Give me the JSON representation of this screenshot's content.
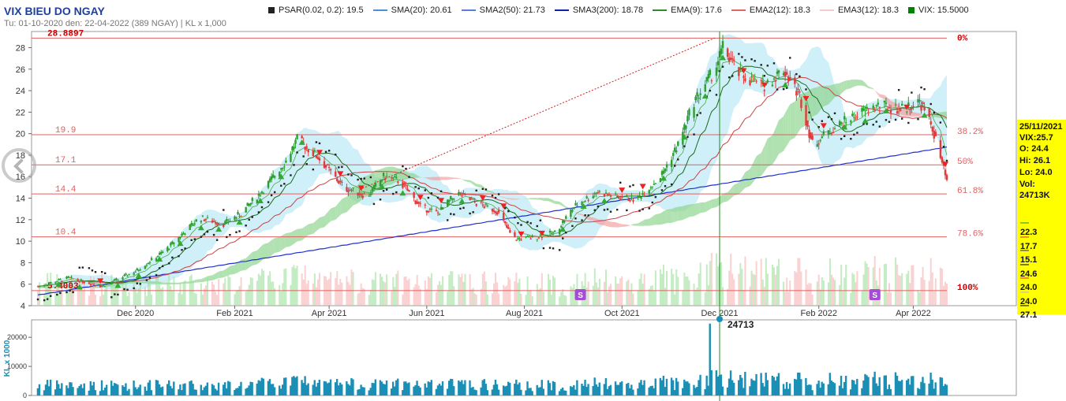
{
  "header": {
    "title": "VIX BIEU DO NGAY",
    "subtitle": "Tu: 01-10-2020 den: 22-04-2022 (389 NGAY) | KL x 1,000"
  },
  "legend": [
    {
      "label": "PSAR(0.02, 0.2): 19.5",
      "color": "#222222",
      "marker": "square"
    },
    {
      "label": "SMA(20): 20.61",
      "color": "#4a90d9",
      "marker": "dot-line"
    },
    {
      "label": "SMA2(50): 21.73",
      "color": "#5b7fd6",
      "marker": "diamond-line"
    },
    {
      "label": "SMA3(200): 18.78",
      "color": "#1020b0",
      "marker": "line"
    },
    {
      "label": "EMA(9): 17.6",
      "color": "#2e8b2e",
      "marker": "line"
    },
    {
      "label": "EMA2(12): 18.3",
      "color": "#e06666",
      "marker": "line"
    },
    {
      "label": "EMA3(12): 18.3",
      "color": "#f4cccc",
      "marker": "line"
    },
    {
      "label": "VIX: 15.5000",
      "color": "#008000",
      "marker": "box"
    }
  ],
  "colors": {
    "up": "#2e9e2e",
    "down": "#e23b3b",
    "sma20": "#1a6b1a",
    "sma200": "#1e2fd0",
    "ema": "#d04040",
    "fib": "#e06060",
    "cloud_green": "#8fd48f",
    "cloud_red": "#f4a0a0",
    "band": "#bfe9f7",
    "volume": "#1b8fb5",
    "side_box": "#ffff00"
  },
  "chart_data": {
    "type": "candlestick",
    "x_tick_labels": [
      "Dec 2020",
      "Feb 2021",
      "Apr 2021",
      "Jun 2021",
      "Aug 2021",
      "Oct 2021",
      "Dec 2021",
      "Feb 2022",
      "Apr 2022"
    ],
    "y_ticks": [
      4,
      6,
      8,
      10,
      12,
      14,
      16,
      18,
      20,
      22,
      24,
      26,
      28
    ],
    "ylim": [
      4,
      29.5
    ],
    "fib_levels": [
      {
        "price": 28.8897,
        "label": "28.8897",
        "pct": "0%"
      },
      {
        "price": 19.9,
        "label": "19.9",
        "pct": "38.2%"
      },
      {
        "price": 17.1,
        "label": "17.1",
        "pct": "50%"
      },
      {
        "price": 14.4,
        "label": "14.4",
        "pct": "61.8%"
      },
      {
        "price": 10.4,
        "label": "10.4",
        "pct": "78.6%"
      },
      {
        "price": 5.4003,
        "label": "5.4003",
        "pct": "100%"
      }
    ],
    "anchors": [
      [
        "2020-10-01",
        5.8
      ],
      [
        "2020-10-20",
        6.6
      ],
      [
        "2020-11-10",
        5.8
      ],
      [
        "2020-12-01",
        7.2
      ],
      [
        "2020-12-20",
        9.2
      ],
      [
        "2021-01-10",
        12.2
      ],
      [
        "2021-01-25",
        11.6
      ],
      [
        "2021-02-05",
        12.6
      ],
      [
        "2021-02-20",
        15.0
      ],
      [
        "2021-03-05",
        17.5
      ],
      [
        "2021-03-12",
        19.5
      ],
      [
        "2021-03-25",
        17.8
      ],
      [
        "2021-04-10",
        15.0
      ],
      [
        "2021-04-25",
        14.2
      ],
      [
        "2021-05-05",
        16.0
      ],
      [
        "2021-05-15",
        15.6
      ],
      [
        "2021-05-28",
        13.2
      ],
      [
        "2021-06-08",
        12.6
      ],
      [
        "2021-06-20",
        14.5
      ],
      [
        "2021-07-01",
        13.6
      ],
      [
        "2021-07-15",
        12.8
      ],
      [
        "2021-07-25",
        10.2
      ],
      [
        "2021-08-05",
        10.3
      ],
      [
        "2021-08-20",
        10.8
      ],
      [
        "2021-09-01",
        13.2
      ],
      [
        "2021-09-15",
        14.6
      ],
      [
        "2021-09-28",
        14.1
      ],
      [
        "2021-10-10",
        13.9
      ],
      [
        "2021-10-25",
        16.0
      ],
      [
        "2021-11-05",
        19.0
      ],
      [
        "2021-11-15",
        23.0
      ],
      [
        "2021-11-28",
        26.0
      ],
      [
        "2021-12-03",
        28.0
      ],
      [
        "2021-12-13",
        25.6
      ],
      [
        "2021-12-28",
        24.4
      ],
      [
        "2022-01-10",
        26.0
      ],
      [
        "2022-01-20",
        23.5
      ],
      [
        "2022-01-28",
        19.0
      ],
      [
        "2022-02-10",
        20.5
      ],
      [
        "2022-02-25",
        21.8
      ],
      [
        "2022-03-10",
        22.6
      ],
      [
        "2022-03-25",
        22.3
      ],
      [
        "2022-04-05",
        23.0
      ],
      [
        "2022-04-13",
        20.5
      ],
      [
        "2022-04-22",
        15.5
      ]
    ],
    "vol_ticks": [
      0,
      10000,
      20000
    ],
    "vol_ylim": [
      0,
      26000
    ],
    "vol_axis_label": "KL x 1000",
    "vol_peak_label": "24713",
    "s_markers": [
      "2021-09-05",
      "2022-03-08"
    ],
    "cursor_date": "2021-12-01",
    "side_box": {
      "date": "25/11/2021",
      "close": "VIX:25.7",
      "open": "O: 24.4",
      "high": "Hi: 26.1",
      "low": "Lo: 24.0",
      "vol_label": "Vol:",
      "vol": "24713K",
      "values": [
        {
          "text": "22.3",
          "color": "#2e9e2e"
        },
        {
          "text": "17.7",
          "color": "#e23b3b"
        },
        {
          "text": "15.1",
          "color": "#1e2fd0"
        },
        {
          "text": "24.6",
          "color": "#111111"
        },
        {
          "text": "24.0",
          "color": "#e23b3b"
        },
        {
          "text": "24.0",
          "color": "#bbbbbb"
        },
        {
          "text": "27.1",
          "color": "#111111"
        }
      ]
    }
  }
}
